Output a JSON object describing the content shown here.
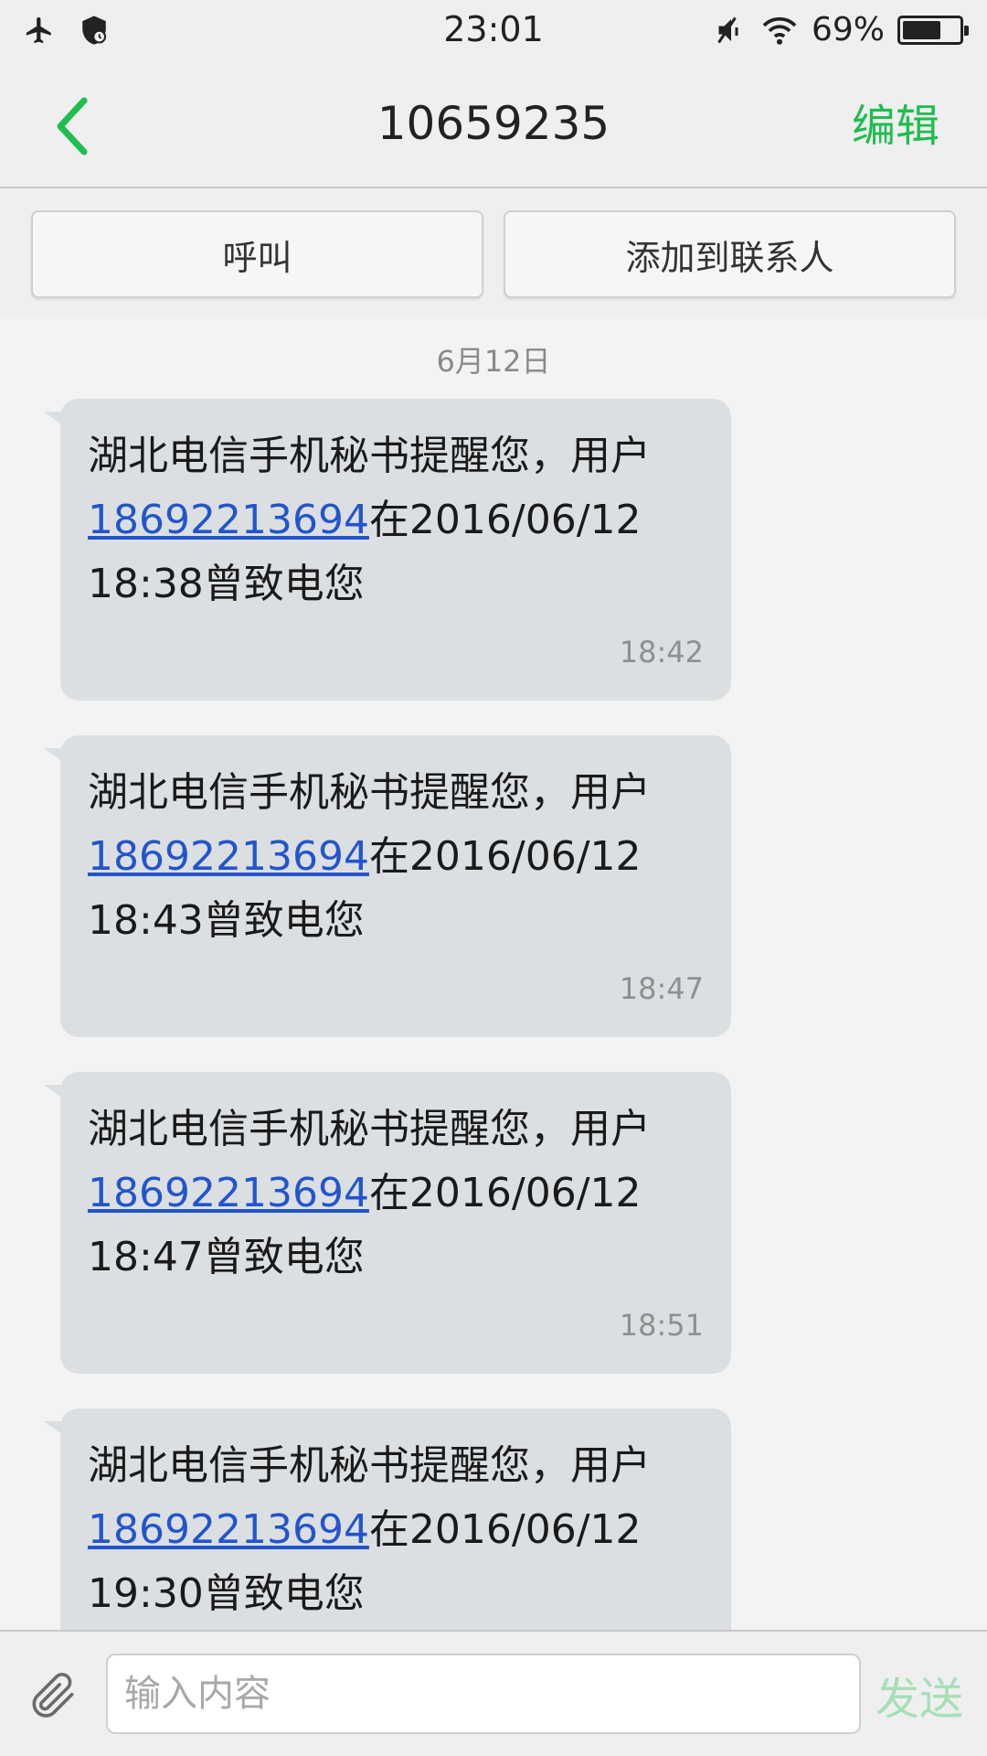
{
  "status_bar": {
    "time": "23:01",
    "battery_text": "69%",
    "battery_level": 0.69,
    "icons": [
      "airplane-icon",
      "shield-icon",
      "mute-icon",
      "wifi-icon",
      "battery-icon"
    ]
  },
  "header": {
    "title": "10659235",
    "edit_label": "编辑",
    "accent_color": "#1fbd4e"
  },
  "actions": {
    "call_label": "呼叫",
    "add_contact_label": "添加到联系人"
  },
  "conversation": {
    "date": "6月12日",
    "messages": [
      {
        "prefix": "湖北电信手机秘书提醒您，用户",
        "phone": "18692213694",
        "suffix": "在2016/06/12",
        "line3": "18:38曾致电您",
        "time": "18:42"
      },
      {
        "prefix": "湖北电信手机秘书提醒您，用户",
        "phone": "18692213694",
        "suffix": "在2016/06/12",
        "line3": "18:43曾致电您",
        "time": "18:47"
      },
      {
        "prefix": "湖北电信手机秘书提醒您，用户",
        "phone": "18692213694",
        "suffix": "在2016/06/12",
        "line3": "18:47曾致电您",
        "time": "18:51"
      },
      {
        "prefix": "湖北电信手机秘书提醒您，用户",
        "phone": "18692213694",
        "suffix": "在2016/06/12",
        "line3": "19:30曾致电您",
        "time": ""
      }
    ]
  },
  "input": {
    "placeholder": "输入内容",
    "value": "",
    "send_label": "发送"
  }
}
